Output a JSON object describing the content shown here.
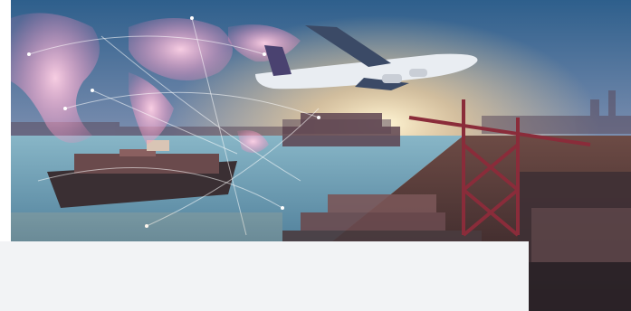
{
  "image": {
    "subject": "logistics-hero-image",
    "colors": {
      "sky_top": "#3b6f9a",
      "sky_horizon": "#f6c47d",
      "sun": "#fff2c9",
      "water": "#4a8aa8",
      "crane": "#8a2c3a",
      "map_glow": "#ff9fc8",
      "plane": "#e9edf2",
      "overlay_panel": "#f2f3f5"
    }
  }
}
